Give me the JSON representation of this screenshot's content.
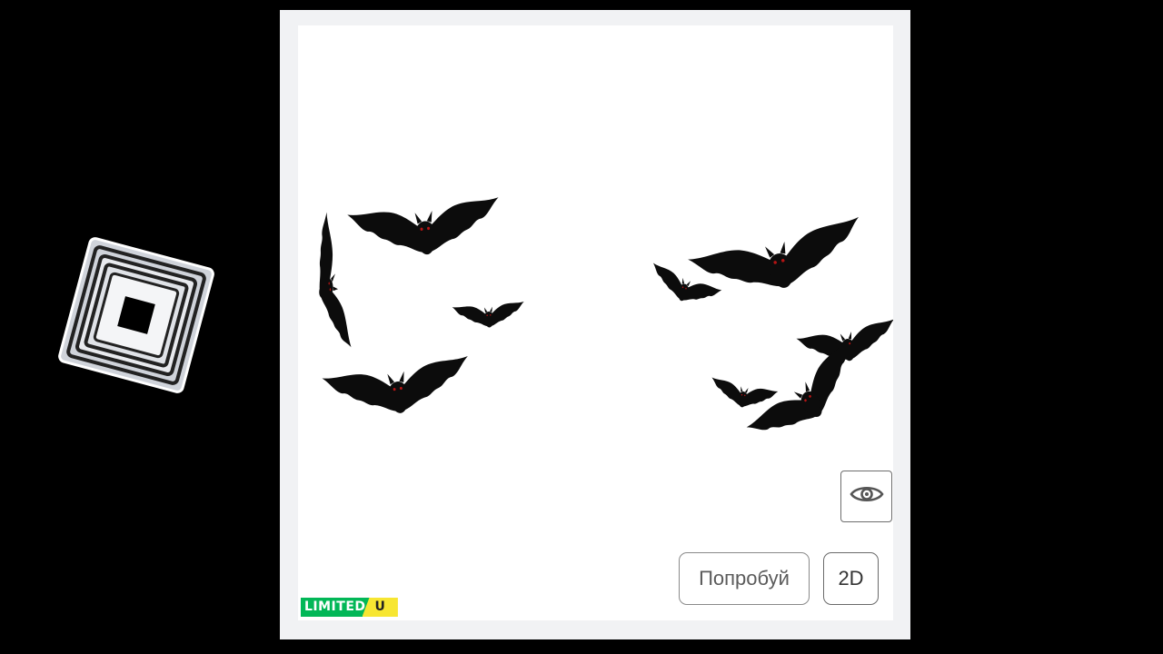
{
  "logo": {
    "icon": "roblox-logo-icon"
  },
  "viewer": {
    "view_icon": "eye-icon",
    "try_on_label": "Попробуй",
    "view_2d_label": "2D",
    "badge": {
      "limited_label": "LIMITED",
      "unique_label": "U"
    },
    "colors": {
      "limited_green": "#02b757",
      "unique_yellow": "#f7e632"
    }
  }
}
